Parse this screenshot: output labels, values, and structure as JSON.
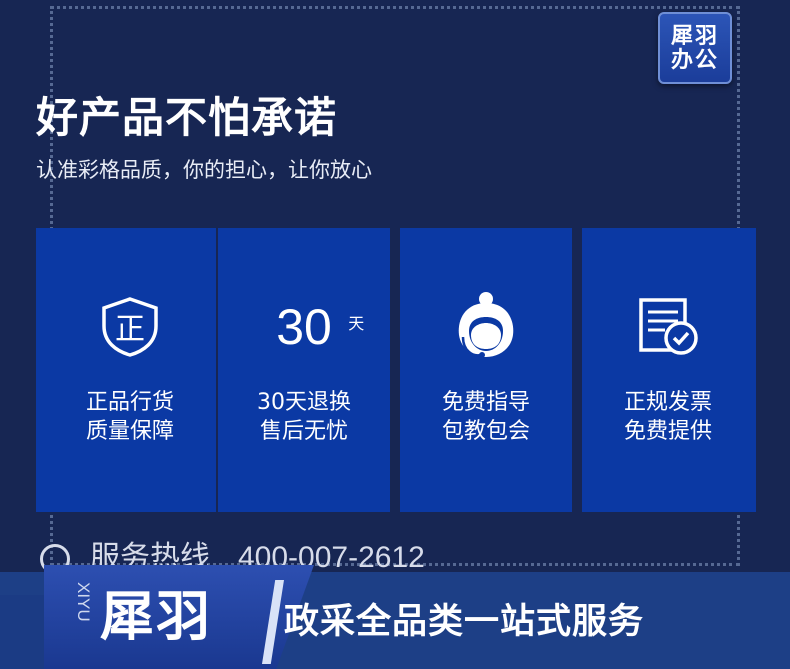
{
  "brand_badge": {
    "line1": "犀羽",
    "line2": "办公"
  },
  "headline": "好产品不怕承诺",
  "subline": "认准彩格品质，你的担心，让你放心",
  "cards": [
    {
      "icon": "shield-zheng-icon",
      "line1": "正品行货",
      "line2": "质量保障"
    },
    {
      "icon": "thirty-days-icon",
      "number": "30",
      "unit": "天",
      "line1": "30天退换",
      "line2": "售后无忧"
    },
    {
      "icon": "customer-service-icon",
      "line1": "免费指导",
      "line2": "包教包会"
    },
    {
      "icon": "invoice-check-icon",
      "line1": "正规发票",
      "line2": "免费提供"
    }
  ],
  "hotline": {
    "label": "服务热线",
    "number": "400-007-2612"
  },
  "footer": {
    "vertical_text": "XIYU",
    "logo": "犀羽",
    "slogan": "政采全品类一站式服务"
  },
  "colors": {
    "background": "#172653",
    "card": "#0b39a4",
    "footer": "#1d3f86",
    "accent": "#2d4fb1"
  }
}
